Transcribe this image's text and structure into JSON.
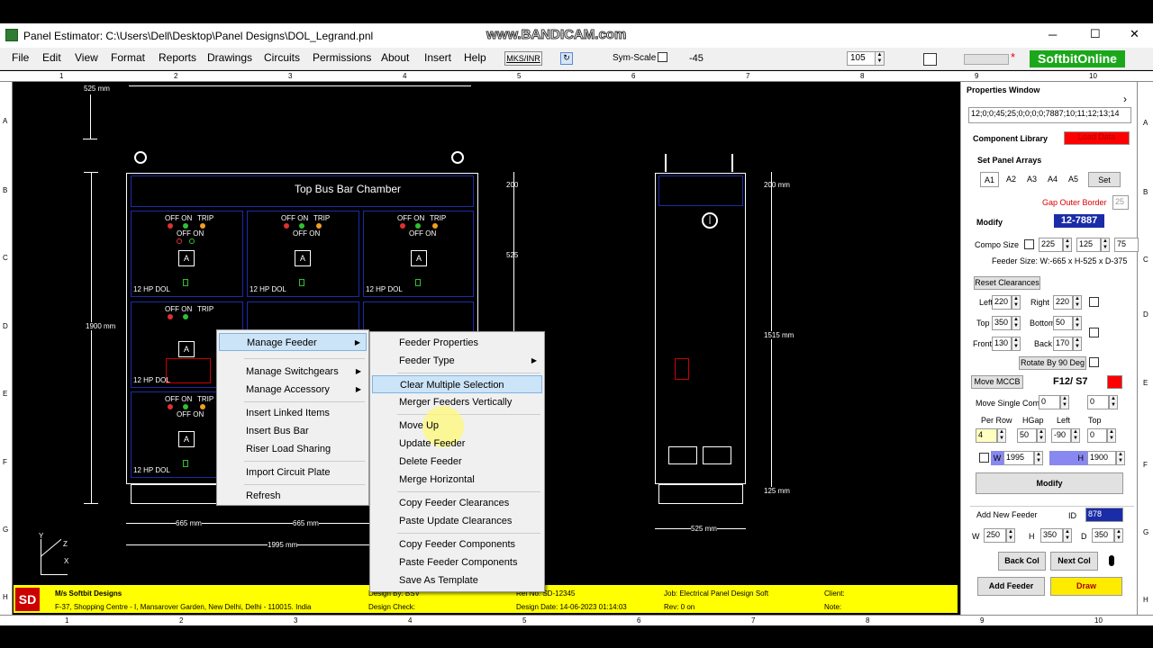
{
  "window": {
    "title": "Panel Estimator: C:\\Users\\Dell\\Desktop\\Panel Designs\\DOL_Legrand.pnl",
    "watermark": "www.BANDICAM.com",
    "min": "─",
    "max": "☐",
    "close": "✕"
  },
  "menu": {
    "items": [
      "File",
      "Edit",
      "View",
      "Format",
      "Reports",
      "Drawings",
      "Circuits",
      "Permissions",
      "About",
      "Insert",
      "Help"
    ],
    "mks_label": "MKS/INR",
    "sym_scale_label": "Sym-Scale",
    "sym_scale_value": "-45",
    "zoom_value": "105",
    "asterisk": "*",
    "brand": "SoftbitOnline"
  },
  "rulers": {
    "top": [
      "1",
      "2",
      "3",
      "4",
      "5",
      "6",
      "7",
      "8",
      "9",
      "10"
    ],
    "left": [
      "A",
      "B",
      "C",
      "D",
      "E",
      "F",
      "G",
      "H"
    ]
  },
  "drawing": {
    "top_dim": "525 mm",
    "bus_chamber": "Top Bus Bar Chamber",
    "height_dim": "1900 mm",
    "dim_200": "200",
    "dim_525": "525",
    "feeder_labels": {
      "off_on": "OFF ON",
      "trip": "TRIP",
      "off_on2": "OFF ON",
      "a": "A",
      "name": "12 HP DOL"
    },
    "width_665a": "665 mm",
    "width_665b": "665 mm",
    "width_1995": "1995 mm",
    "side_top_dim": "200 mm",
    "side_height": "1515 mm",
    "side_bottom": "125 mm",
    "side_width": "525 mm",
    "axis_y": "Y",
    "axis_x": "X",
    "axis_z": "Z"
  },
  "context_menu": {
    "main": [
      {
        "label": "Manage Feeder",
        "sub": true
      },
      {
        "label": "Manage Switchgears",
        "sub": true
      },
      {
        "label": "Manage Accessory",
        "sub": true
      },
      {
        "label": "Insert Linked Items"
      },
      {
        "label": "Insert Bus Bar"
      },
      {
        "label": "Riser Load Sharing"
      },
      {
        "label": "Import Circuit Plate"
      },
      {
        "label": "Refresh"
      }
    ],
    "sub": [
      {
        "label": "Feeder Properties"
      },
      {
        "label": "Feeder Type"
      },
      {
        "label": "Clear Multiple Selection"
      },
      {
        "label": "Merger Feeders Vertically"
      },
      {
        "label": "Move Up"
      },
      {
        "label": "Update Feeder"
      },
      {
        "label": "Delete Feeder"
      },
      {
        "label": "Merge Horizontal"
      },
      {
        "label": "Copy Feeder Clearances"
      },
      {
        "label": "Paste  Update Clearances"
      },
      {
        "label": "Copy Feeder Components"
      },
      {
        "label": "Paste Feeder Components"
      },
      {
        "label": "Save As Template"
      }
    ]
  },
  "properties": {
    "title": "Properties Window",
    "combo_value": "12;0;0;45;25;0;0;0;0;7887;10;11;12;13;14",
    "component_library": "Component Library",
    "load_data": "Load Data",
    "set_panel_arrays": "Set Panel Arrays",
    "arrays": [
      "A1",
      "A2",
      "A3",
      "A4",
      "A5"
    ],
    "set": "Set",
    "gap_outer_border": "Gap Outer Border",
    "gap_value": "25",
    "modify_label": "Modify",
    "feeder_id": "12-7887",
    "compo_size": "Compo Size",
    "compo_w": "225",
    "compo_h": "125",
    "compo_d": "75",
    "feeder_size": "Feeder Size: W:-665 x H-525 x D-375",
    "reset_clearances": "Reset Clearances",
    "left": "Left",
    "left_v": "220",
    "right": "Right",
    "right_v": "220",
    "top": "Top",
    "top_v": "350",
    "bottom": "Bottom",
    "bottom_v": "50",
    "front": "Front",
    "front_v": "130",
    "back": "Back",
    "back_v": "170",
    "rotate": "Rotate By 90 Deg",
    "move_mccb": "Move MCCB",
    "f12": "F12/ S7",
    "move_single": "Move Single Compo",
    "move_a": "0",
    "move_b": "0",
    "per_row": "Per Row",
    "hgap": "HGap",
    "left2": "Left",
    "top2": "Top",
    "per_row_v": "4",
    "hgap_v": "50",
    "left2_v": "-90",
    "top2_v": "0",
    "w_label": "W",
    "w_value": "1995",
    "h_label": "H",
    "h_value": "1900",
    "modify_btn": "Modify",
    "add_new_feeder": "Add New Feeder",
    "id_label": "ID",
    "id_value": "878",
    "nw_label": "W",
    "nw": "250",
    "nh_label": "H",
    "nh": "350",
    "nd_label": "D",
    "nd": "350",
    "back_col": "Back Col",
    "next_col": "Next Col",
    "add_feeder": "Add Feeder",
    "draw": "Draw"
  },
  "title_block": {
    "logo": "SD",
    "company": "M/s Softbit Designs",
    "address": "F-37, Shopping Centre - I, Mansarover Garden, New Delhi, Delhi - 110015. India",
    "design_by": "Design By: BSV",
    "design_check": "Design Check:",
    "ref_no": "Ref No: SD-12345",
    "design_date": "Design Date: 14-06-2023 01:14:03",
    "job": "Job: Electrical Panel Design Soft",
    "rev": "Rev: 0 on",
    "client": "Client:",
    "note": "Note:"
  },
  "colors": {
    "accent_blue": "#1a2ca8",
    "red": "#ff0000",
    "yellow": "#ffff00",
    "highlight": "#cce4f7"
  }
}
